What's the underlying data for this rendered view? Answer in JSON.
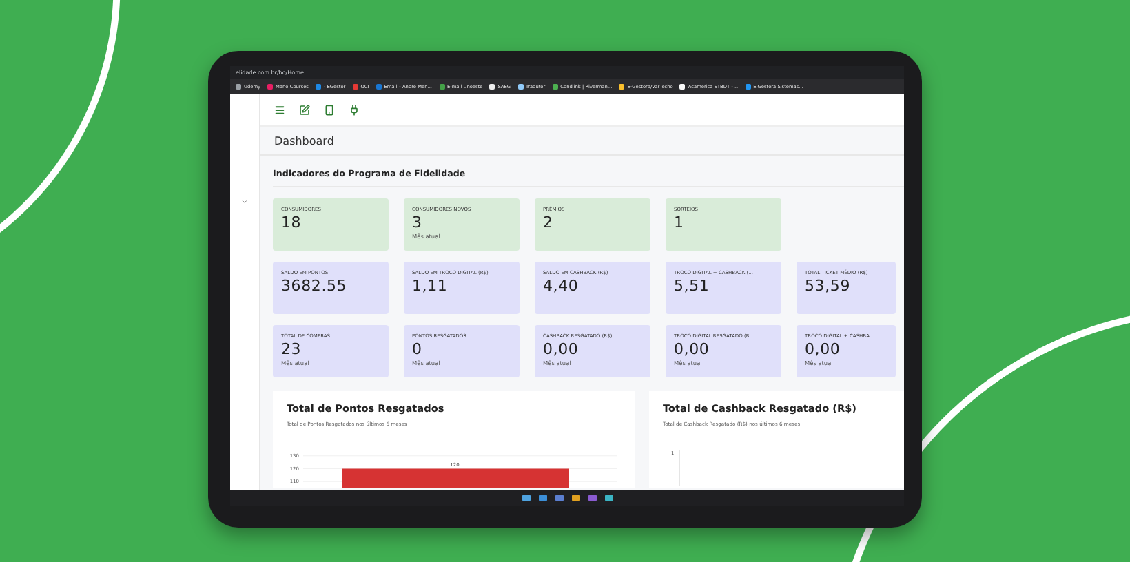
{
  "browser": {
    "url": "elidade.com.br/bo/Home",
    "bookmarks": [
      {
        "label": "Udemy",
        "color": "#9aa0a6"
      },
      {
        "label": "Mano Courses",
        "color": "#e91e63"
      },
      {
        "label": "- EGestor",
        "color": "#1e88e5"
      },
      {
        "label": "OCI",
        "color": "#e53935"
      },
      {
        "label": "Email – André Men...",
        "color": "#1976d2"
      },
      {
        "label": "E-mail Unoeste",
        "color": "#43a047"
      },
      {
        "label": "SAEG",
        "color": "#eeeeee"
      },
      {
        "label": "Tradutor",
        "color": "#90caf9"
      },
      {
        "label": "Condlink | Riverman...",
        "color": "#4caf50"
      },
      {
        "label": "E-Gestora/VarTecho",
        "color": "#fbc02d"
      },
      {
        "label": "Acamerica STBDT –...",
        "color": "#fafafa"
      },
      {
        "label": "E Gestora Sistemas...",
        "color": "#2196f3"
      }
    ]
  },
  "page": {
    "title": "Dashboard",
    "section_title": "Indicadores do Programa de Fidelidade"
  },
  "card_rows": [
    {
      "cards": [
        {
          "label": "CONSUMIDORES",
          "value": "18",
          "color": "#d9ecd9"
        },
        {
          "label": "CONSUMIDORES NOVOS",
          "value": "3",
          "note": "Mês atual",
          "color": "#d9ecd9"
        },
        {
          "label": "PRÊMIOS",
          "value": "2",
          "color": "#d9ecd9"
        },
        {
          "label": "SORTEIOS",
          "value": "1",
          "color": "#d9ecd9"
        }
      ]
    },
    {
      "cards": [
        {
          "label": "SALDO EM PONTOS",
          "value": "3682.55",
          "color": "#e0e0fa"
        },
        {
          "label": "SALDO EM TROCO DIGITAL (R$)",
          "value": "1,11",
          "color": "#e0e0fa"
        },
        {
          "label": "SALDO EM CASHBACK (R$)",
          "value": "4,40",
          "color": "#e0e0fa"
        },
        {
          "label": "TROCO DIGITAL + CASHBACK (...",
          "value": "5,51",
          "color": "#e0e0fa"
        },
        {
          "label": "TOTAL TICKET MÉDIO (R$)",
          "value": "53,59",
          "color": "#e0e0fa"
        }
      ]
    },
    {
      "cards": [
        {
          "label": "TOTAL DE COMPRAS",
          "value": "23",
          "note": "Mês atual",
          "color": "#e0e0fa"
        },
        {
          "label": "PONTOS RESGATADOS",
          "value": "0",
          "note": "Mês atual",
          "color": "#e0e0fa"
        },
        {
          "label": "CASHBACK RESGATADO (R$)",
          "value": "0,00",
          "note": "Mês atual",
          "color": "#e0e0fa"
        },
        {
          "label": "TROCO DIGITAL RESGATADO (R...",
          "value": "0,00",
          "note": "Mês atual",
          "color": "#e0e0fa"
        },
        {
          "label": "TROCO DIGITAL + CASHBA",
          "value": "0,00",
          "note": "Mês atual",
          "color": "#e0e0fa"
        }
      ]
    }
  ],
  "charts": [
    {
      "title": "Total de Pontos Resgatados",
      "subtitle": "Total de Pontos Resgatados nos últimos 6 meses",
      "chart_data": {
        "type": "bar",
        "values": [
          120
        ],
        "ylim": [
          100,
          132
        ],
        "yticks": [
          110,
          120,
          130
        ],
        "data_labels": true
      }
    },
    {
      "title": "Total de Cashback Resgatado (R$)",
      "subtitle": "Total de Cashback Resgatado (R$) nos últimos 6 meses",
      "axis_tick": "1"
    }
  ]
}
